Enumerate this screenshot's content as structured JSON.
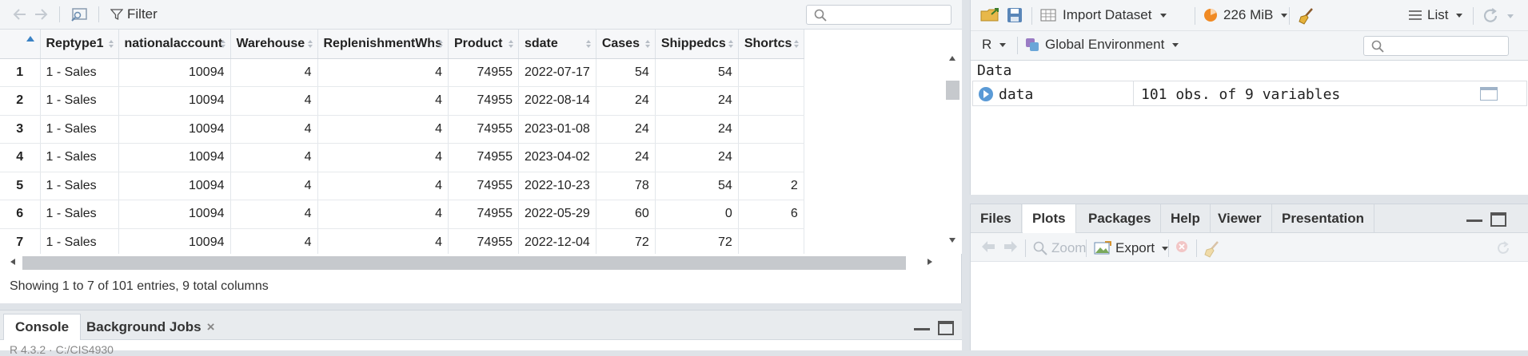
{
  "viewer": {
    "filter_label": "Filter",
    "columns": [
      "Reptype1",
      "nationalaccount",
      "Warehouse",
      "ReplenishmentWhs",
      "Product",
      "sdate",
      "Cases",
      "Shippedcs",
      "Shortcs"
    ],
    "rows": [
      {
        "n": "1",
        "cells": [
          "1 - Sales",
          "10094",
          "4",
          "4",
          "74955",
          "2022-07-17",
          "54",
          "54",
          ""
        ]
      },
      {
        "n": "2",
        "cells": [
          "1 - Sales",
          "10094",
          "4",
          "4",
          "74955",
          "2022-08-14",
          "24",
          "24",
          ""
        ]
      },
      {
        "n": "3",
        "cells": [
          "1 - Sales",
          "10094",
          "4",
          "4",
          "74955",
          "2023-01-08",
          "24",
          "24",
          ""
        ]
      },
      {
        "n": "4",
        "cells": [
          "1 - Sales",
          "10094",
          "4",
          "4",
          "74955",
          "2023-04-02",
          "24",
          "24",
          ""
        ]
      },
      {
        "n": "5",
        "cells": [
          "1 - Sales",
          "10094",
          "4",
          "4",
          "74955",
          "2022-10-23",
          "78",
          "54",
          "2"
        ]
      },
      {
        "n": "6",
        "cells": [
          "1 - Sales",
          "10094",
          "4",
          "4",
          "74955",
          "2022-05-29",
          "60",
          "0",
          "6"
        ]
      },
      {
        "n": "7",
        "cells": [
          "1 - Sales",
          "10094",
          "4",
          "4",
          "74955",
          "2022-12-04",
          "72",
          "72",
          ""
        ]
      }
    ],
    "entries_text": "Showing 1 to 7 of 101 entries, 9 total columns"
  },
  "console": {
    "tabs": [
      "Console",
      "Background Jobs"
    ],
    "partial_line": "R 4.3.2 · C:/CIS4930"
  },
  "environment": {
    "import_label": "Import Dataset",
    "memory_label": "226 MiB",
    "view_mode": "List",
    "language": "R",
    "scope": "Global Environment",
    "section": "Data",
    "object_name": "data",
    "object_desc": "101 obs. of 9 variables"
  },
  "files_pane": {
    "tabs": [
      "Files",
      "Plots",
      "Packages",
      "Help",
      "Viewer",
      "Presentation"
    ],
    "zoom_label": "Zoom",
    "export_label": "Export"
  }
}
